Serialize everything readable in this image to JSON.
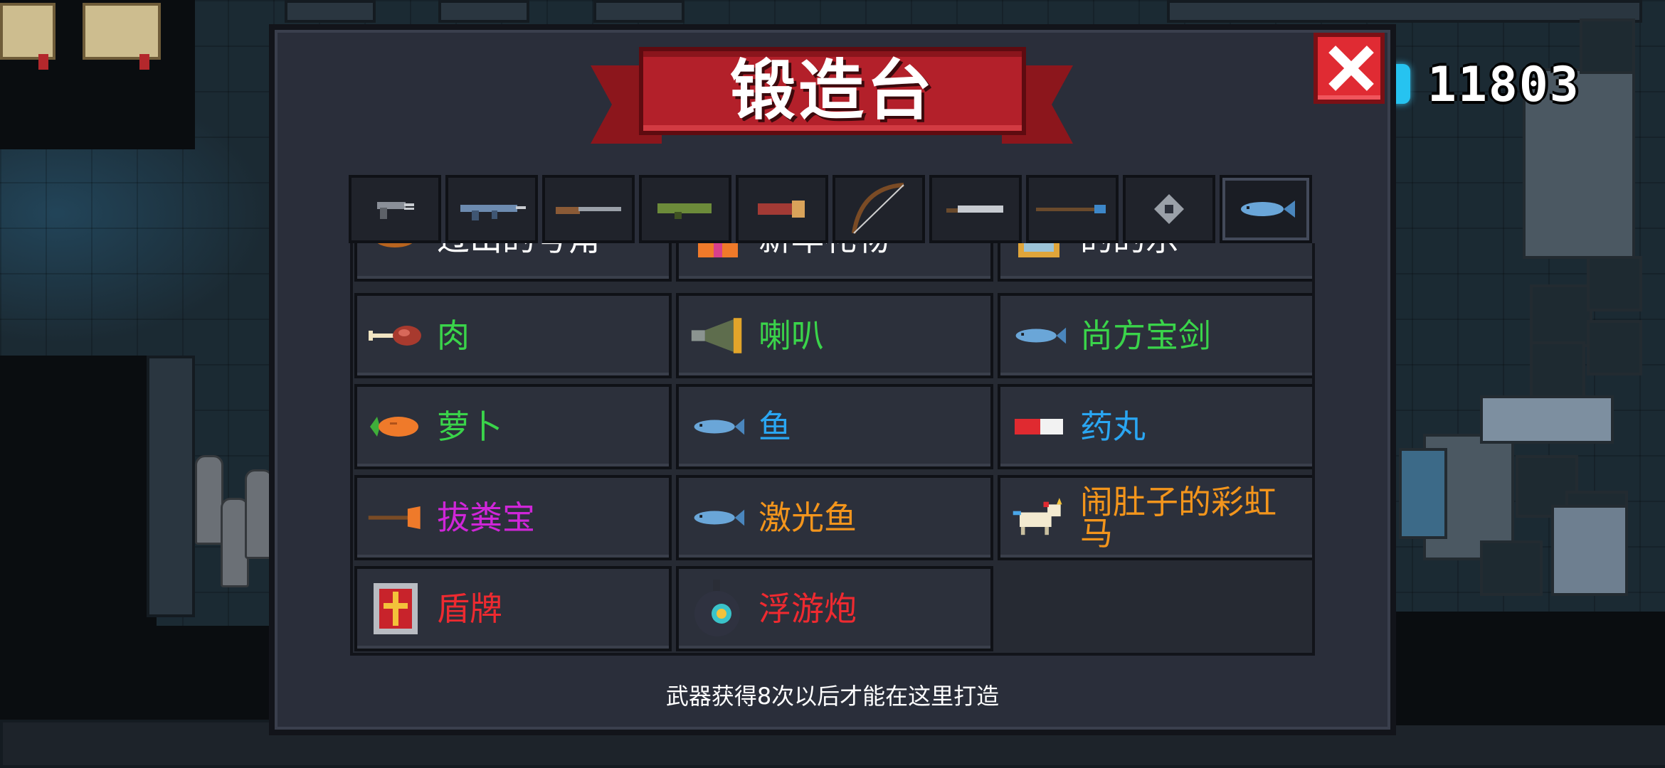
{
  "hud": {
    "currency_icon": "gem-icon",
    "currency_amount": "11803"
  },
  "dialog": {
    "title": "锻造台",
    "close_icon": "close-icon",
    "footer_note": "武器获得8次以后才能在这里打造"
  },
  "tabs": [
    {
      "name": "pistol-category",
      "icon": "pistol-icon",
      "active": false
    },
    {
      "name": "rifle-category",
      "icon": "rifle-icon",
      "active": false
    },
    {
      "name": "shotgun-category",
      "icon": "shotgun-icon",
      "active": false
    },
    {
      "name": "launcher-category",
      "icon": "rocket-launcher-icon",
      "active": false
    },
    {
      "name": "special-launcher-category",
      "icon": "cannon-icon",
      "active": false
    },
    {
      "name": "bow-category",
      "icon": "bow-icon",
      "active": false
    },
    {
      "name": "melee-category",
      "icon": "blade-icon",
      "active": false
    },
    {
      "name": "staff-category",
      "icon": "staff-icon",
      "active": false
    },
    {
      "name": "throwable-category",
      "icon": "shuriken-icon",
      "active": false
    },
    {
      "name": "other-category",
      "icon": "fish-icon",
      "active": true
    }
  ],
  "items": [
    {
      "label": "过山的号角",
      "color": "white",
      "icon": "horn-icon",
      "partial": true
    },
    {
      "label": "新年礼物",
      "color": "white",
      "icon": "gift-icon",
      "partial": true
    },
    {
      "label": "的的乐",
      "color": "white",
      "icon": "box-icon",
      "partial": true
    },
    {
      "label": "肉",
      "color": "green",
      "icon": "meat-icon"
    },
    {
      "label": "喇叭",
      "color": "green",
      "icon": "loudspeaker-icon"
    },
    {
      "label": "尚方宝剑",
      "color": "green",
      "icon": "fish-sword-icon"
    },
    {
      "label": "萝卜",
      "color": "green",
      "icon": "carrot-icon"
    },
    {
      "label": "鱼",
      "color": "blue",
      "icon": "fish-icon"
    },
    {
      "label": "药丸",
      "color": "blue",
      "icon": "pill-icon"
    },
    {
      "label": "拔粪宝",
      "color": "purple",
      "icon": "plunger-icon"
    },
    {
      "label": "激光鱼",
      "color": "orange",
      "icon": "laser-fish-icon"
    },
    {
      "label": "闹肚子的彩虹马",
      "color": "orange",
      "icon": "unicorn-icon"
    },
    {
      "label": "盾牌",
      "color": "red",
      "icon": "shield-icon"
    },
    {
      "label": "浮游炮",
      "color": "red",
      "icon": "floating-cannon-icon"
    }
  ]
}
